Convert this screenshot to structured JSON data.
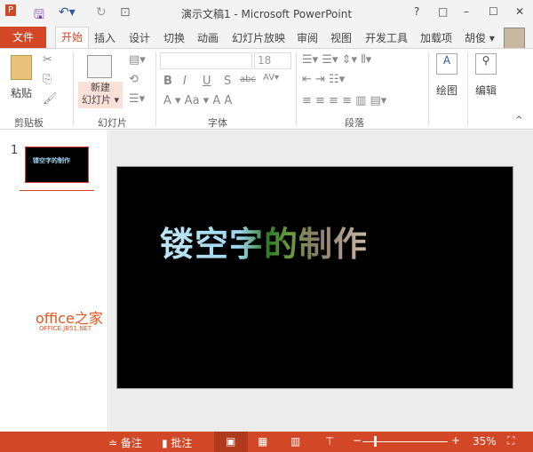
{
  "title": "演示文稿1 - Microsoft PowerPoint",
  "window_controls": [
    "?",
    "□",
    "–",
    "☐",
    "✕"
  ],
  "tabs": {
    "file": "文件",
    "home": "开始",
    "items": [
      "插入",
      "设计",
      "切换",
      "动画",
      "幻灯片放映",
      "审阅",
      "视图",
      "开发工具",
      "加载项"
    ],
    "user": "胡俊 ▾"
  },
  "ribbon": {
    "paste": "粘贴",
    "new_slide_1": "新建",
    "new_slide_2": "幻灯片 ▾",
    "font_size": "18",
    "draw": "绘图",
    "edit": "编辑",
    "groups": [
      "剪贴板",
      "幻灯片",
      "字体",
      "段落"
    ]
  },
  "thumb": {
    "number": "1",
    "text": "镂空字的制作"
  },
  "slide": {
    "text": "镂空字的制作"
  },
  "watermark": {
    "line1": "office之家",
    "line2": "OFFICE.JB51.NET"
  },
  "status": {
    "notes": "备注",
    "comments": "批注",
    "zoom": "35%"
  },
  "colors": {
    "accent": "#D24726"
  }
}
